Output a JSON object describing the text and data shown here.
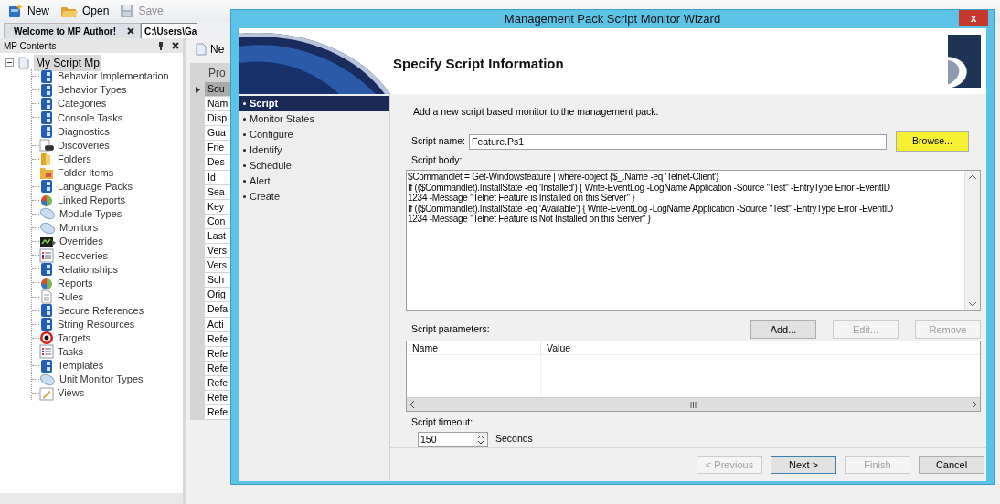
{
  "toolbar": [
    {
      "label": "New",
      "kind": "new",
      "disabled": false
    },
    {
      "label": "Open",
      "kind": "open",
      "disabled": false
    },
    {
      "label": "Save",
      "kind": "save",
      "disabled": true
    }
  ],
  "doc_tabs": [
    {
      "label": "Welcome to MP Author!",
      "selected": false
    },
    {
      "label": "C:\\Users\\Ga",
      "selected": true
    }
  ],
  "mp_contents": {
    "title": "MP Contents",
    "root": {
      "label": "My Script Mp",
      "selected": true,
      "expanded": true,
      "children": [
        {
          "label": "Behavior Implementation",
          "kind": "cube"
        },
        {
          "label": "Behavior Types",
          "kind": "cube"
        },
        {
          "label": "Categories",
          "kind": "cube"
        },
        {
          "label": "Console Tasks",
          "kind": "cube"
        },
        {
          "label": "Diagnostics",
          "kind": "cube"
        },
        {
          "label": "Discoveries",
          "kind": "discovery"
        },
        {
          "label": "Folders",
          "kind": "folder"
        },
        {
          "label": "Folder Items",
          "kind": "folder-items"
        },
        {
          "label": "Language Packs",
          "kind": "cube"
        },
        {
          "label": "Linked Reports",
          "kind": "report"
        },
        {
          "label": "Module Types",
          "kind": "pill"
        },
        {
          "label": "Monitors",
          "kind": "pill"
        },
        {
          "label": "Overrides",
          "kind": "override"
        },
        {
          "label": "Recoveries",
          "kind": "list"
        },
        {
          "label": "Relationships",
          "kind": "cube"
        },
        {
          "label": "Reports",
          "kind": "report"
        },
        {
          "label": "Rules",
          "kind": "doc"
        },
        {
          "label": "Secure References",
          "kind": "cube"
        },
        {
          "label": "String Resources",
          "kind": "cube"
        },
        {
          "label": "Targets",
          "kind": "target"
        },
        {
          "label": "Tasks",
          "kind": "list"
        },
        {
          "label": "Templates",
          "kind": "cube"
        },
        {
          "label": "Unit Monitor Types",
          "kind": "pill"
        },
        {
          "label": "Views",
          "kind": "view"
        }
      ]
    }
  },
  "property_panel": {
    "toolbar_label": "Ne",
    "header": "Pro",
    "rows": [
      {
        "label": "Sou",
        "selected": true
      },
      {
        "label": "Nam",
        "selected": false
      },
      {
        "label": "Disp",
        "selected": false
      },
      {
        "label": "Gua",
        "selected": false
      },
      {
        "label": "Frie",
        "selected": false
      },
      {
        "label": "Des",
        "selected": false
      },
      {
        "label": "Id",
        "selected": false
      },
      {
        "label": "Sea",
        "selected": false
      },
      {
        "label": "Key",
        "selected": false
      },
      {
        "label": "Con",
        "selected": false
      },
      {
        "label": "Last",
        "selected": false
      },
      {
        "label": "Vers",
        "selected": false
      },
      {
        "label": "Vers",
        "selected": false
      },
      {
        "label": "Sch",
        "selected": false
      },
      {
        "label": "Orig",
        "selected": false
      },
      {
        "label": "Defa",
        "selected": false
      },
      {
        "label": "Acti",
        "selected": false
      },
      {
        "label": "Refe",
        "selected": false
      },
      {
        "label": "Refe",
        "selected": false
      },
      {
        "label": "Refe",
        "selected": false
      },
      {
        "label": "Refe",
        "selected": false
      },
      {
        "label": "Refe",
        "selected": false
      },
      {
        "label": "Refe",
        "selected": false
      }
    ]
  },
  "wizard": {
    "title": "Management Pack Script Monitor Wizard",
    "close": "x",
    "heading": "Specify Script Information",
    "steps": [
      {
        "label": "Script",
        "selected": true
      },
      {
        "label": "Monitor States",
        "selected": false
      },
      {
        "label": "Configure",
        "selected": false
      },
      {
        "label": "Identify",
        "selected": false
      },
      {
        "label": "Schedule",
        "selected": false
      },
      {
        "label": "Alert",
        "selected": false
      },
      {
        "label": "Create",
        "selected": false
      }
    ],
    "intro": "Add a new script based monitor to the management pack.",
    "script_name": {
      "label": "Script name:",
      "value": "Feature.Ps1"
    },
    "browse": {
      "label": "Browse...",
      "highlighted": true
    },
    "script_body": {
      "label": "Script body:",
      "lines": [
        "$Commandlet = Get-Windowsfeature | where-object {$_.Name -eq 'Telnet-Client'}",
        "If (($Commandlet).InstallState -eq 'Installed') { Write-EventLog -LogName Application -Source \"Test\" -EntryType Error -EventID",
        "1234 -Message \"Telnet Feature is Installed on this Server\" }",
        "If (($Commandlet).InstallState -eq 'Available') { Write-EventLog -LogName Application -Source \"Test\" -EntryType Error -EventID",
        "1234 -Message \"Telnet Feature is Not Installed on this Server\" }"
      ]
    },
    "parameters": {
      "label": "Script parameters:",
      "buttons": [
        {
          "label": "Add...",
          "disabled": false
        },
        {
          "label": "Edit...",
          "disabled": true
        },
        {
          "label": "Remove",
          "disabled": true
        }
      ],
      "columns": [
        "Name",
        "Value"
      ]
    },
    "timeout": {
      "label": "Script timeout:",
      "value": "150",
      "unit": "Seconds"
    },
    "buttons": [
      {
        "label": "< Previous",
        "disabled": true
      },
      {
        "label": "Next >",
        "disabled": false,
        "default": true
      },
      {
        "label": "Finish",
        "disabled": true
      },
      {
        "label": "Cancel",
        "disabled": false
      }
    ]
  }
}
